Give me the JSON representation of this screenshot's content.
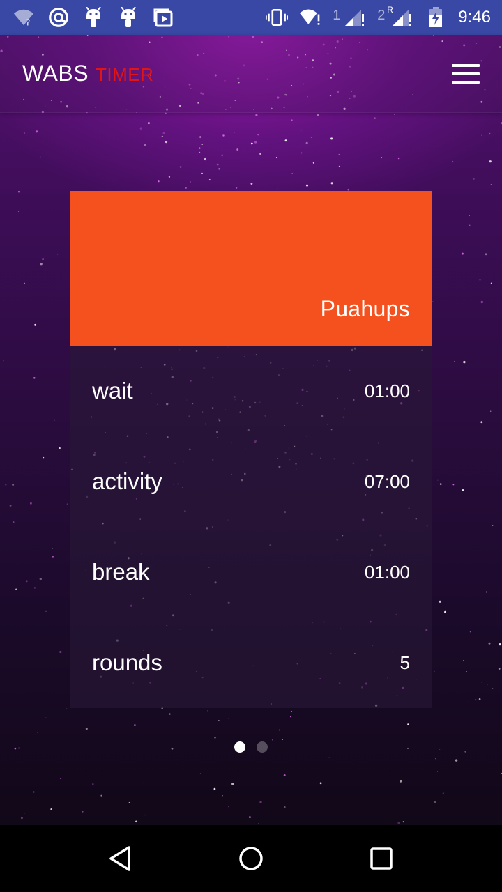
{
  "status_bar": {
    "time": "9:46",
    "icons": [
      "wifi-question-icon",
      "at-icon",
      "android-icon",
      "android-icon",
      "media-icon",
      "vibrate-icon",
      "wifi-alert-icon",
      "signal-1-icon",
      "signal-2-roaming-icon",
      "battery-charging-icon"
    ],
    "sim1_label": "1",
    "sim2_label": "2",
    "sim2_roaming": "R"
  },
  "app_bar": {
    "title_main": "WABS",
    "title_sub": "TIMER",
    "menu_icon": "hamburger-menu-icon",
    "accent_color": "#e01616"
  },
  "card": {
    "title": "Puahups",
    "header_color": "#f4511e",
    "rows": [
      {
        "label": "wait",
        "value": "01:00"
      },
      {
        "label": "activity",
        "value": "07:00"
      },
      {
        "label": "break",
        "value": "01:00"
      },
      {
        "label": "rounds",
        "value": "5"
      }
    ]
  },
  "pager": {
    "total": 2,
    "active_index": 0
  },
  "nav_bar": {
    "icons": [
      "back-icon",
      "home-icon",
      "recents-icon"
    ]
  }
}
